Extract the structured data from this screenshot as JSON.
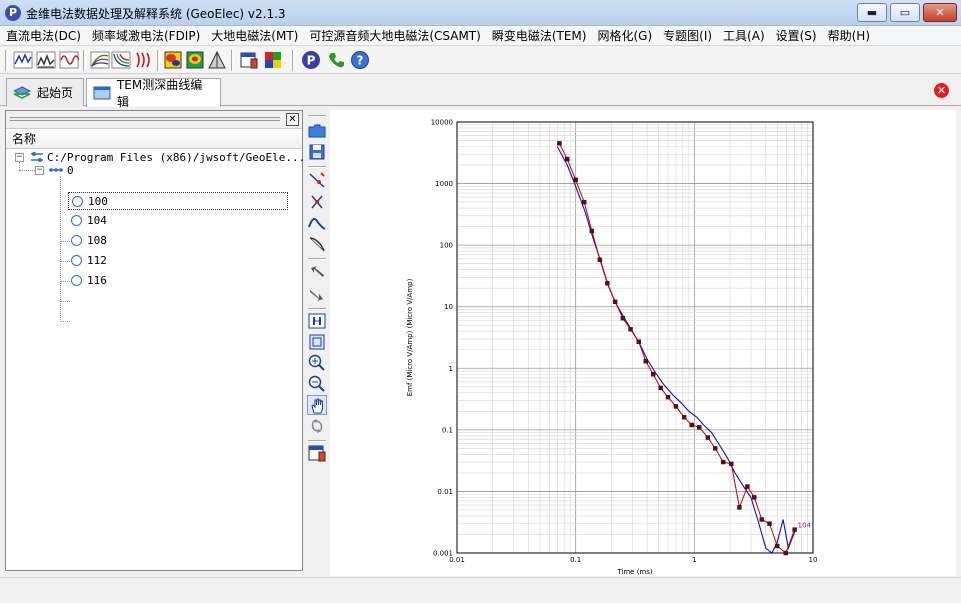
{
  "window": {
    "title": "金维电法数据处理及解释系统 (GeoElec)  v2.1.3",
    "minimize_label": "▬",
    "maximize_label": "▭",
    "close_label": "✕"
  },
  "menu": [
    "直流电法(DC)",
    "频率域激电法(FDIP)",
    "大地电磁法(MT)",
    "可控源音频大地电磁法(CSAMT)",
    "瞬变电磁法(TEM)",
    "网格化(G)",
    "专题图(I)",
    "工具(A)",
    "设置(S)",
    "帮助(H)"
  ],
  "tabs": [
    {
      "label": "起始页",
      "active": false
    },
    {
      "label": "TEM测深曲线编辑",
      "active": true
    }
  ],
  "tree": {
    "column_header": "名称",
    "root": "C:/Program Files (x86)/jwsoft/GeoEle...",
    "line": "0",
    "stations": [
      "100",
      "104",
      "108",
      "112",
      "116"
    ],
    "selected": "100"
  },
  "colors": {
    "measured": "#c00000",
    "model": "#1010c0",
    "marker": "#5a1010",
    "label": "#a0206a"
  },
  "chart_data": {
    "type": "line",
    "xscale": "log",
    "yscale": "log",
    "xlim": [
      0.01,
      10
    ],
    "ylim": [
      0.001,
      10000
    ],
    "xticks": [
      "0.01",
      "0.1",
      "1",
      "10"
    ],
    "yticks": [
      "0.001",
      "0.01",
      "0.1",
      "1",
      "10",
      "100",
      "1000",
      "10000"
    ],
    "ylabel": "Emf (Micro V/Amp) (Micro V/Amp)",
    "xlabel": "Time (ms)",
    "grid": true,
    "series_label": "104",
    "series": [
      {
        "name": "measured",
        "x": [
          0.073,
          0.085,
          0.1,
          0.118,
          0.137,
          0.16,
          0.185,
          0.215,
          0.25,
          0.29,
          0.34,
          0.39,
          0.45,
          0.52,
          0.6,
          0.7,
          0.82,
          0.95,
          1.1,
          1.3,
          1.5,
          1.75,
          2.05,
          2.4,
          2.8,
          3.2,
          3.7,
          4.3,
          5.0,
          5.9,
          7.0
        ],
        "y": [
          4500,
          2500,
          1150,
          500,
          170,
          58,
          24,
          12,
          6.5,
          4.3,
          2.7,
          1.3,
          0.8,
          0.48,
          0.34,
          0.24,
          0.16,
          0.12,
          0.11,
          0.075,
          0.05,
          0.03,
          0.028,
          0.0055,
          0.012,
          0.008,
          0.0035,
          0.003,
          0.0013,
          0.001,
          0.0024
        ]
      },
      {
        "name": "model",
        "x": [
          0.07,
          0.085,
          0.1,
          0.12,
          0.14,
          0.165,
          0.19,
          0.22,
          0.26,
          0.3,
          0.35,
          0.4,
          0.47,
          0.55,
          0.65,
          0.78,
          0.9,
          1.05,
          1.2,
          1.4,
          1.6,
          1.9,
          2.2,
          2.6,
          3.0,
          3.5,
          4.0,
          4.5,
          5.0,
          5.6,
          6.2,
          7.0
        ],
        "y": [
          4000,
          2000,
          900,
          350,
          130,
          50,
          21,
          11,
          6.3,
          4.0,
          2.4,
          1.4,
          0.85,
          0.55,
          0.38,
          0.27,
          0.2,
          0.16,
          0.12,
          0.09,
          0.06,
          0.035,
          0.02,
          0.012,
          0.008,
          0.003,
          0.0012,
          0.001,
          0.0015,
          0.0035,
          0.0012,
          0.0022
        ]
      }
    ]
  }
}
